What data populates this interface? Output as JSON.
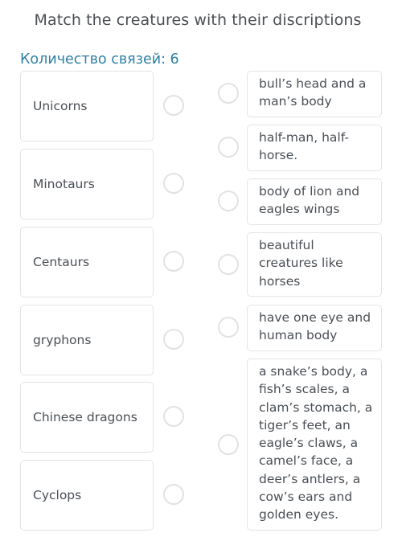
{
  "title": "Match the creatures with their discriptions",
  "connections_label": "Количество связей: 6",
  "left_items": [
    {
      "label": "Unicorns"
    },
    {
      "label": "Minotaurs"
    },
    {
      "label": "Centaurs"
    },
    {
      "label": "gryphons"
    },
    {
      "label": "Chinese dragons"
    },
    {
      "label": "Cyclops"
    }
  ],
  "right_items": [
    {
      "label": "bull’s head and a man’s body"
    },
    {
      "label": "half-man, half-horse."
    },
    {
      "label": "body of lion and eagles wings"
    },
    {
      "label": "beautiful creatures like horses"
    },
    {
      "label": "have one eye and human body"
    },
    {
      "label": "a snake’s body, a fish’s scales, a clam’s stomach, a tiger’s feet, an eagle’s claws, a camel’s face, a deer’s antlers, a cow’s ears and golden eyes."
    }
  ]
}
